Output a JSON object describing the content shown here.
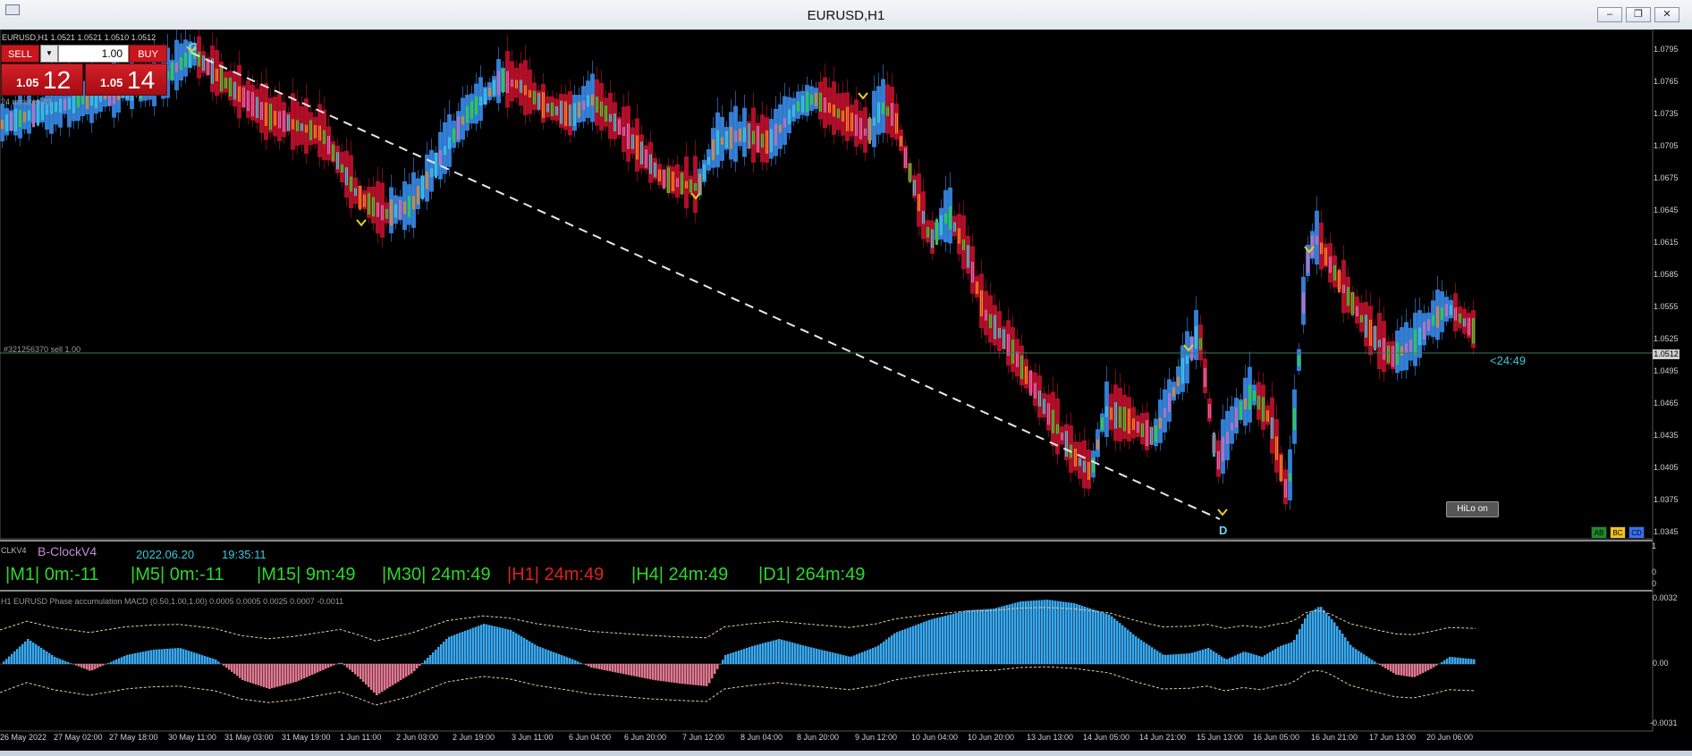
{
  "window": {
    "title": "EURUSD,H1",
    "minimize_glyph": "–",
    "restore_glyph": "❐",
    "close_glyph": "✕"
  },
  "symbol_info": "EURUSD,H1  1.0521 1.0521 1.0510 1.0512",
  "trade_panel": {
    "sell_label": "SELL",
    "buy_label": "BUY",
    "volume": "1.00",
    "sell_price_small": "1.05",
    "sell_price_big": "12",
    "buy_price_small": "1.05",
    "buy_price_big": "14",
    "time_left": "24 minutes 49"
  },
  "order_line_label": "#321256370 sell 1.00",
  "countdown": "<24:49",
  "current_price_tag": "1.0512",
  "hilo_button": "HiLo on",
  "pattern_buttons": [
    "AB",
    "BC",
    "CD"
  ],
  "pattern_points": {
    "c": "C",
    "d": "D"
  },
  "price_axis": [
    "1.0795",
    "1.0765",
    "1.0735",
    "1.0705",
    "1.0675",
    "1.0645",
    "1.0615",
    "1.0585",
    "1.0555",
    "1.0525",
    "1.0495",
    "1.0465",
    "1.0435",
    "1.0405",
    "1.0375",
    "1.0345"
  ],
  "clock": {
    "short_name": "CLKV4",
    "name": "B-ClockV4",
    "date": "2022.06.20",
    "time": "19:35:11",
    "axis": [
      "1",
      "0",
      "0"
    ],
    "timeframes": [
      {
        "text": "|M1| 0m:-11",
        "red": false
      },
      {
        "text": "|M5| 0m:-11",
        "red": false
      },
      {
        "text": "|M15| 9m:49",
        "red": false
      },
      {
        "text": "|M30| 24m:49",
        "red": false
      },
      {
        "text": "|H1| 24m:49",
        "red": true
      },
      {
        "text": "|H4| 24m:49",
        "red": false
      },
      {
        "text": "|D1| 264m:49",
        "red": false
      }
    ]
  },
  "macd": {
    "label": "H1 EURUSD Phase accumulation MACD (0.50,1.00,1.00) 0.0005 0.0005 0.0025 0.0007 -0.0011",
    "axis": [
      "0.0032",
      "0.00",
      "-0.0031"
    ]
  },
  "time_axis": [
    "26 May 2022",
    "27 May 02:00",
    "27 May 18:00",
    "30 May 11:00",
    "31 May 03:00",
    "31 May 19:00",
    "1 Jun 11:00",
    "2 Jun 03:00",
    "2 Jun 19:00",
    "3 Jun 11:00",
    "6 Jun 04:00",
    "6 Jun 20:00",
    "7 Jun 12:00",
    "8 Jun 04:00",
    "8 Jun 20:00",
    "9 Jun 12:00",
    "10 Jun 04:00",
    "10 Jun 20:00",
    "13 Jun 13:00",
    "14 Jun 05:00",
    "14 Jun 21:00",
    "15 Jun 13:00",
    "16 Jun 05:00",
    "16 Jun 21:00",
    "17 Jun 13:00",
    "20 Jun 06:00"
  ],
  "colors": {
    "bull": "#3a8ef0",
    "bear": "#c8102e",
    "green": "#2bd82b",
    "cyan": "#3ac8d8",
    "orange": "#f08a1c",
    "magenta": "#d46bb6",
    "macd_pos": "#38a8f0",
    "macd_neg": "#e07890"
  }
}
